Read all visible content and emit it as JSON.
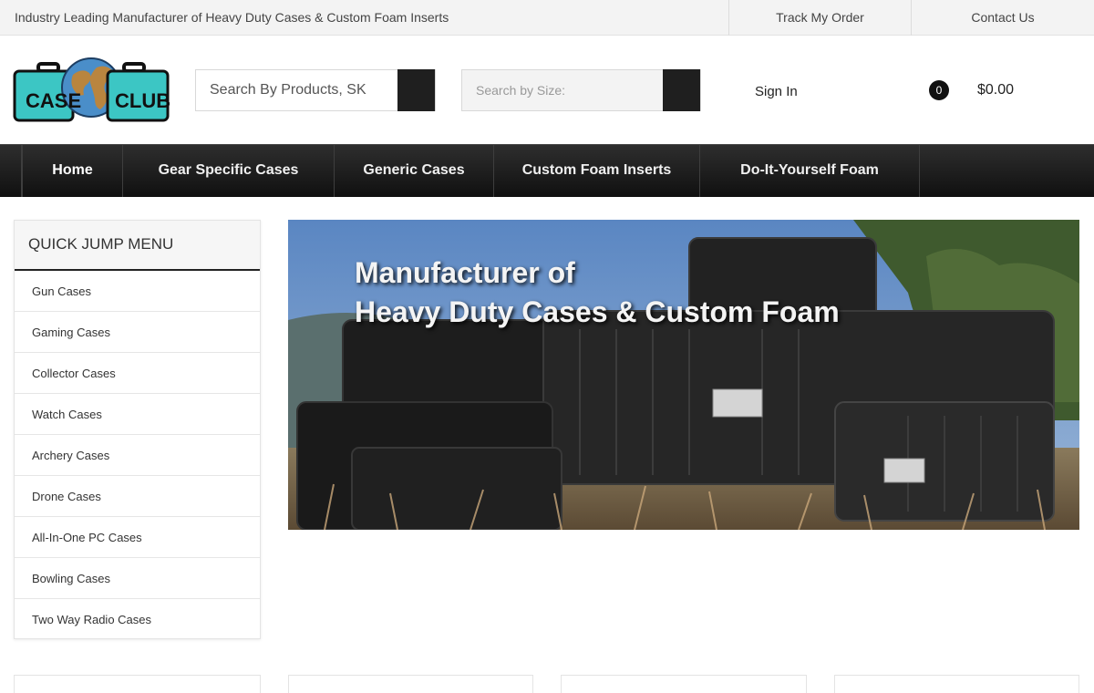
{
  "topbar": {
    "tagline": "Industry Leading Manufacturer of Heavy Duty Cases & Custom Foam Inserts",
    "track_order": "Track My Order",
    "contact_us": "Contact Us"
  },
  "header": {
    "logo_text_left": "CASE",
    "logo_text_right": "CLUB",
    "search_products_placeholder": "Search By Products, SK",
    "search_size_placeholder": "Search by Size:",
    "sign_in": "Sign In",
    "cart_count": "0",
    "cart_total": "$0.00"
  },
  "nav": {
    "items": [
      {
        "label": "Home"
      },
      {
        "label": "Gear Specific Cases"
      },
      {
        "label": "Generic Cases"
      },
      {
        "label": "Custom Foam Inserts"
      },
      {
        "label": "Do-It-Yourself Foam"
      }
    ]
  },
  "sidebar": {
    "title": "QUICK JUMP MENU",
    "links": [
      {
        "label": "Gun Cases"
      },
      {
        "label": "Gaming Cases"
      },
      {
        "label": "Collector Cases"
      },
      {
        "label": "Watch Cases"
      },
      {
        "label": "Archery Cases"
      },
      {
        "label": "Drone Cases"
      },
      {
        "label": "All-In-One PC Cases"
      },
      {
        "label": "Bowling Cases"
      },
      {
        "label": "Two Way Radio Cases"
      }
    ]
  },
  "hero": {
    "line1": "Manufacturer of",
    "line2": "Heavy Duty Cases & Custom Foam"
  },
  "colors": {
    "nav_background": "#1a1a1a",
    "topbar_background": "#f3f3f3",
    "logo_case_teal": "#3cc6c4",
    "logo_globe_blue": "#4a8ec9"
  },
  "icons": {
    "search_button": "search-icon",
    "cart": "cart-icon"
  }
}
